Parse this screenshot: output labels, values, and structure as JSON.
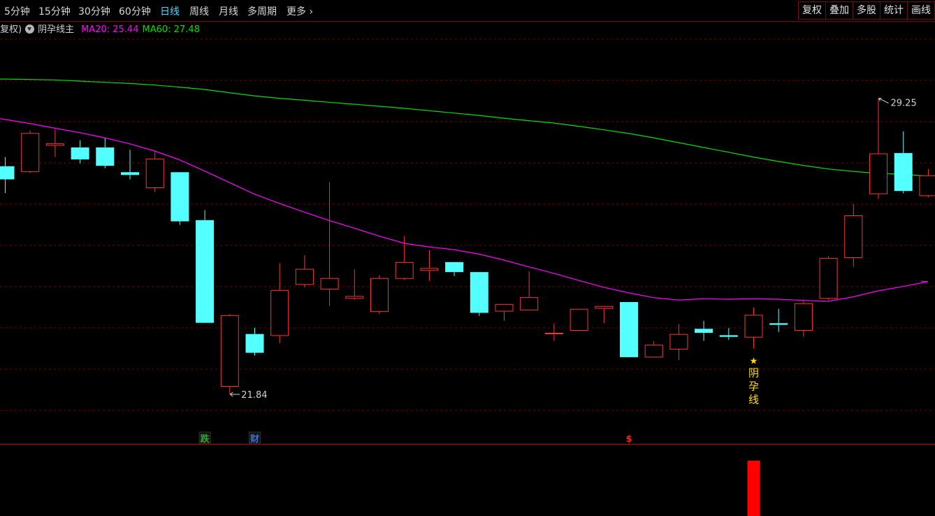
{
  "toolbar": {
    "periods": [
      "5分钟",
      "15分钟",
      "30分钟",
      "60分钟",
      "日线",
      "周线",
      "月线",
      "多周期",
      "更多"
    ],
    "active_period": "日线",
    "right_buttons": [
      "复权",
      "叠加",
      "多股",
      "统计",
      "画线"
    ]
  },
  "legend": {
    "adjust_label": "复权)",
    "indicator_name": "阴孕线主",
    "ma20_label": "MA20: 25.44",
    "ma60_label": "MA60: 27.48"
  },
  "colors": {
    "up": "#ff3232",
    "down": "#54ffff",
    "ma20": "#ff00ff",
    "ma60": "#00e000",
    "grid": "#7a0000",
    "signal": "#ffe000",
    "volume_bar": "#ff0000"
  },
  "chart_data": {
    "type": "candlestick",
    "ylim": [
      21.0,
      30.8
    ],
    "candles": [
      {
        "o": 27.55,
        "h": 27.78,
        "l": 26.88,
        "c": 27.22
      },
      {
        "o": 27.42,
        "h": 28.45,
        "l": 27.38,
        "c": 28.38
      },
      {
        "o": 28.08,
        "h": 28.48,
        "l": 27.78,
        "c": 28.12
      },
      {
        "o": 28.02,
        "h": 28.2,
        "l": 27.62,
        "c": 27.72
      },
      {
        "o": 28.02,
        "h": 28.25,
        "l": 27.5,
        "c": 27.56
      },
      {
        "o": 27.4,
        "h": 27.96,
        "l": 27.22,
        "c": 27.33
      },
      {
        "o": 27.02,
        "h": 27.92,
        "l": 26.9,
        "c": 27.74
      },
      {
        "o": 27.4,
        "h": 27.4,
        "l": 26.08,
        "c": 26.17
      },
      {
        "o": 26.2,
        "h": 26.45,
        "l": 23.63,
        "c": 23.63
      },
      {
        "o": 22.05,
        "h": 23.85,
        "l": 21.84,
        "c": 23.82
      },
      {
        "o": 23.35,
        "h": 23.51,
        "l": 22.81,
        "c": 22.88
      },
      {
        "o": 23.32,
        "h": 25.12,
        "l": 23.12,
        "c": 24.45
      },
      {
        "o": 24.6,
        "h": 25.32,
        "l": 24.52,
        "c": 24.98
      },
      {
        "o": 24.48,
        "h": 27.15,
        "l": 24.05,
        "c": 24.75
      },
      {
        "o": 24.25,
        "h": 24.97,
        "l": 24.2,
        "c": 24.3
      },
      {
        "o": 23.92,
        "h": 24.82,
        "l": 23.85,
        "c": 24.75
      },
      {
        "o": 24.75,
        "h": 25.8,
        "l": 24.7,
        "c": 25.15
      },
      {
        "o": 24.95,
        "h": 25.45,
        "l": 24.68,
        "c": 25.0
      },
      {
        "o": 25.15,
        "h": 25.15,
        "l": 24.8,
        "c": 24.9
      },
      {
        "o": 24.9,
        "h": 24.9,
        "l": 23.8,
        "c": 23.88
      },
      {
        "o": 23.93,
        "h": 24.1,
        "l": 23.68,
        "c": 24.1
      },
      {
        "o": 23.96,
        "h": 24.92,
        "l": 23.95,
        "c": 24.27
      },
      {
        "o": 23.38,
        "h": 23.62,
        "l": 23.18,
        "c": 23.38
      },
      {
        "o": 23.45,
        "h": 23.98,
        "l": 23.45,
        "c": 23.98
      },
      {
        "o": 24.0,
        "h": 24.05,
        "l": 23.62,
        "c": 24.05
      },
      {
        "o": 24.15,
        "h": 24.15,
        "l": 22.77,
        "c": 22.77
      },
      {
        "o": 22.78,
        "h": 23.17,
        "l": 22.78,
        "c": 23.08
      },
      {
        "o": 22.98,
        "h": 23.6,
        "l": 22.7,
        "c": 23.35
      },
      {
        "o": 23.48,
        "h": 23.68,
        "l": 23.18,
        "c": 23.38
      },
      {
        "o": 23.32,
        "h": 23.5,
        "l": 23.2,
        "c": 23.28
      },
      {
        "o": 23.28,
        "h": 24.01,
        "l": 22.99,
        "c": 23.83
      },
      {
        "o": 23.62,
        "h": 23.98,
        "l": 23.4,
        "c": 23.58
      },
      {
        "o": 23.45,
        "h": 24.18,
        "l": 23.28,
        "c": 24.12
      },
      {
        "o": 24.25,
        "h": 25.3,
        "l": 24.2,
        "c": 25.25
      },
      {
        "o": 25.27,
        "h": 26.6,
        "l": 25.03,
        "c": 26.32
      },
      {
        "o": 26.87,
        "h": 29.25,
        "l": 26.73,
        "c": 27.87
      },
      {
        "o": 27.88,
        "h": 28.42,
        "l": 26.87,
        "c": 26.93
      },
      {
        "o": 26.82,
        "h": 27.48,
        "l": 26.77,
        "c": 27.32
      }
    ],
    "ma20": [
      28.72,
      28.62,
      28.5,
      28.39,
      28.26,
      28.11,
      27.93,
      27.71,
      27.43,
      27.14,
      26.85,
      26.62,
      26.4,
      26.19,
      26.0,
      25.8,
      25.62,
      25.53,
      25.46,
      25.35,
      25.2,
      25.03,
      24.87,
      24.69,
      24.52,
      24.38,
      24.26,
      24.2,
      24.23,
      24.22,
      24.23,
      24.22,
      24.19,
      24.17,
      24.28,
      24.43,
      24.54,
      24.66
    ],
    "ma60": [
      29.73,
      29.72,
      29.71,
      29.68,
      29.65,
      29.62,
      29.58,
      29.53,
      29.47,
      29.39,
      29.31,
      29.25,
      29.2,
      29.15,
      29.1,
      29.05,
      29.0,
      28.94,
      28.88,
      28.82,
      28.75,
      28.69,
      28.63,
      28.55,
      28.46,
      28.37,
      28.26,
      28.14,
      28.02,
      27.9,
      27.78,
      27.67,
      27.57,
      27.48,
      27.42,
      27.37,
      27.35,
      27.3
    ],
    "max_label": "29.25",
    "min_label": "21.84",
    "signal_index": 30,
    "signal_star": "★",
    "signal_text": [
      "阴",
      "孕",
      "线"
    ],
    "markers": [
      {
        "index": 8,
        "text": "跌",
        "color": "#2fa82f"
      },
      {
        "index": 10,
        "text": "财",
        "color": "#3a6fd8"
      },
      {
        "index": 25,
        "text": "$",
        "color": "#ff2020"
      }
    ],
    "volume": [
      {
        "index": 30,
        "value": 1.0
      }
    ]
  }
}
